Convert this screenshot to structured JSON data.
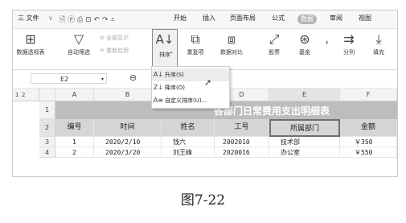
{
  "menubar": {
    "file": "三 文件",
    "tabs": [
      "开始",
      "插入",
      "页面布局",
      "公式",
      "数据",
      "审阅",
      "视图"
    ],
    "active_tab": "数据"
  },
  "ribbon": {
    "pivot": "数据透视表",
    "autofilter": "自动筛选",
    "show_all": "全部显示",
    "reapply": "重新应用",
    "sort": "排序",
    "duplicates": "重复项",
    "compare": "数据对比",
    "stock": "股票",
    "fund": "基金",
    "split": "分列",
    "fill": "填充"
  },
  "formula": {
    "cell_ref": "E2"
  },
  "grid": {
    "outline_levels": [
      "1",
      "2"
    ],
    "columns": [
      "A",
      "B",
      "C",
      "D",
      "E",
      "F"
    ],
    "rows": [
      "1",
      "2",
      "3",
      "4"
    ],
    "title": "各部门日常费用支出明细表",
    "headers": [
      "编号",
      "时间",
      "姓名",
      "工号",
      "所属部门",
      "金额"
    ],
    "data": [
      [
        "1",
        "2020/2/10",
        "钱六",
        "2002010",
        "技术部",
        "￥350"
      ],
      [
        "2",
        "2020/3/20",
        "刘王峰",
        "2020016",
        "办公室",
        "￥550"
      ]
    ]
  },
  "sort_menu": {
    "items": [
      {
        "icon": "sort-ascending-icon",
        "label": "升序(S)"
      },
      {
        "icon": "sort-descending-icon",
        "label": "降序(O)"
      },
      {
        "icon": "custom-sort-icon",
        "label": "自定义排序(U)..."
      }
    ]
  },
  "caption": "图7-22",
  "colors": {
    "title_band": "#bdbdbd",
    "header_band": "#d5d5d5",
    "active_tab_bg": "#b5b5b5"
  }
}
